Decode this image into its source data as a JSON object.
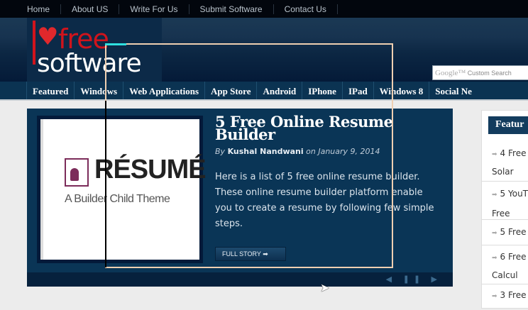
{
  "top_nav": [
    "Home",
    "About US",
    "Write For Us",
    "Submit Software",
    "Contact Us"
  ],
  "logo": {
    "line1": "free",
    "line2": "software"
  },
  "search": {
    "placeholder": "Custom Search",
    "brand": "Google™"
  },
  "main_nav": [
    "Featured",
    "Windows",
    "Web Applications",
    "App Store",
    "Android",
    "IPhone",
    "IPad",
    "Windows 8",
    "Social Ne"
  ],
  "slide": {
    "image": {
      "heading": "RÉSUMÉ",
      "tagline": "A Builder Child Theme"
    },
    "title": "5 Free Online Resume Builder",
    "by": "By",
    "author": "Kushal Nandwani",
    "on": "on January 9, 2014",
    "excerpt": "Here is a list of 5 free online resume builder. These online resume builder platform enable you to create a resume by following few simple steps.",
    "button": "FULL STORY ➡",
    "controls": "◀ ❚❚ ▶"
  },
  "sidebar": {
    "heading": "Featur",
    "items": [
      "4 Free",
      "Solar",
      "5 YouT",
      "Free",
      "5 Free",
      "6 Free",
      "Calcul",
      "3 Free"
    ]
  }
}
